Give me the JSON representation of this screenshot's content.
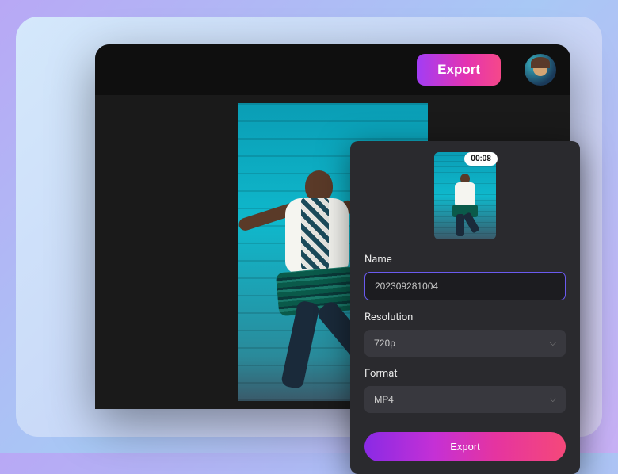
{
  "header": {
    "export_button_label": "Export"
  },
  "export_panel": {
    "duration": "00:08",
    "name_label": "Name",
    "name_value": "202309281004",
    "resolution_label": "Resolution",
    "resolution_value": "720p",
    "format_label": "Format",
    "format_value": "MP4",
    "export_action_label": "Export"
  }
}
